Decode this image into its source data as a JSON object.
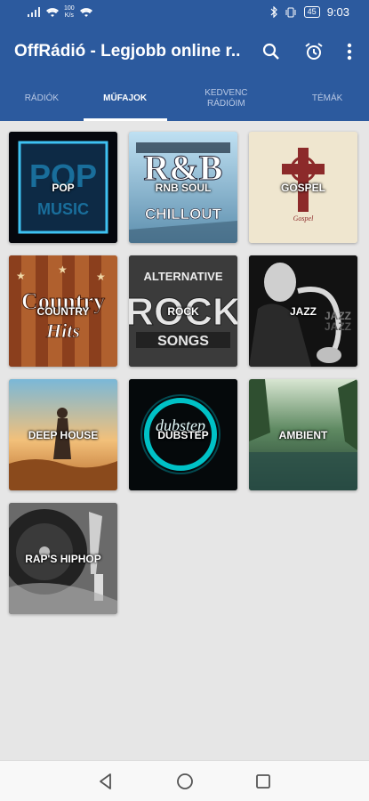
{
  "status_bar": {
    "speed_value": "100",
    "speed_unit": "K/s",
    "battery": "45",
    "time": "9:03"
  },
  "app_bar": {
    "title": "OffRádió - Legjobb online r...",
    "icons": [
      "search-icon",
      "alarm-icon",
      "more-vert-icon"
    ]
  },
  "tabs": [
    {
      "label": "RÁDIÓK",
      "active": false
    },
    {
      "label": "MŰFAJOK",
      "active": true
    },
    {
      "label": "KEDVENC RÁDIÓIM",
      "active": false
    },
    {
      "label": "TÉMÁK",
      "active": false
    }
  ],
  "genres": [
    {
      "label": "POP",
      "art_text": "POP MUSIC"
    },
    {
      "label": "RNB SOUL",
      "art_text": "WORLDS GREATEST R&B CHILLOUT"
    },
    {
      "label": "GOSPEL",
      "art_text": "Gospel"
    },
    {
      "label": "COUNTRY",
      "art_text": "Country Hits"
    },
    {
      "label": "ROCK",
      "art_text": "ALTERNATIVE ROCK SONGS"
    },
    {
      "label": "JAZZ",
      "art_text": "JAZZ JAZZ"
    },
    {
      "label": "DEEP HOUSE",
      "art_text": ""
    },
    {
      "label": "DUBSTEP",
      "art_text": "dubstep"
    },
    {
      "label": "AMBIENT",
      "art_text": ""
    },
    {
      "label": "RAP'S HIPHOP",
      "art_text": ""
    }
  ],
  "colors": {
    "primary": "#2c5a9e",
    "background": "#e6e6e6"
  }
}
